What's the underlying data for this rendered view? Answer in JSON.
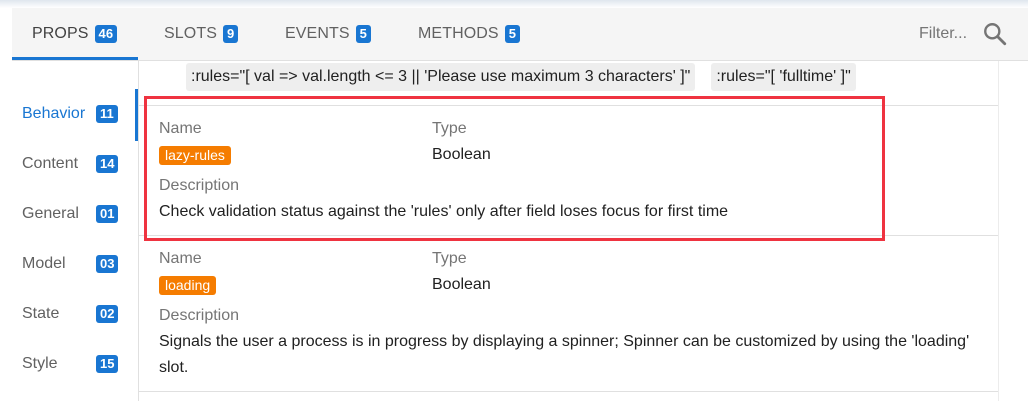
{
  "tabs": [
    {
      "label": "PROPS",
      "count": "46"
    },
    {
      "label": "SLOTS",
      "count": "9"
    },
    {
      "label": "EVENTS",
      "count": "5"
    },
    {
      "label": "METHODS",
      "count": "5"
    }
  ],
  "filter": {
    "placeholder": "Filter..."
  },
  "categories": [
    {
      "label": "Behavior",
      "count": "11"
    },
    {
      "label": "Content",
      "count": "14"
    },
    {
      "label": "General",
      "count": "01"
    },
    {
      "label": "Model",
      "count": "03"
    },
    {
      "label": "State",
      "count": "02"
    },
    {
      "label": "Style",
      "count": "15"
    }
  ],
  "examples": [
    ":rules=\"[ val => val.length <= 3 || 'Please use maximum 3 characters' ]\"",
    ":rules=\"[ 'fulltime' ]\""
  ],
  "field_labels": {
    "name": "Name",
    "type": "Type",
    "description": "Description"
  },
  "props": [
    {
      "name": "lazy-rules",
      "type": "Boolean",
      "description": "Check validation status against the 'rules' only after field loses focus for first time"
    },
    {
      "name": "loading",
      "type": "Boolean",
      "description": "Signals the user a process is in progress by displaying a spinner; Spinner can be customized by using the 'loading' slot."
    }
  ],
  "colors": {
    "accent": "#1976d2",
    "name_chip": "#f57c00",
    "highlight": "#ef3340"
  },
  "icons": {
    "search": "search-icon"
  }
}
